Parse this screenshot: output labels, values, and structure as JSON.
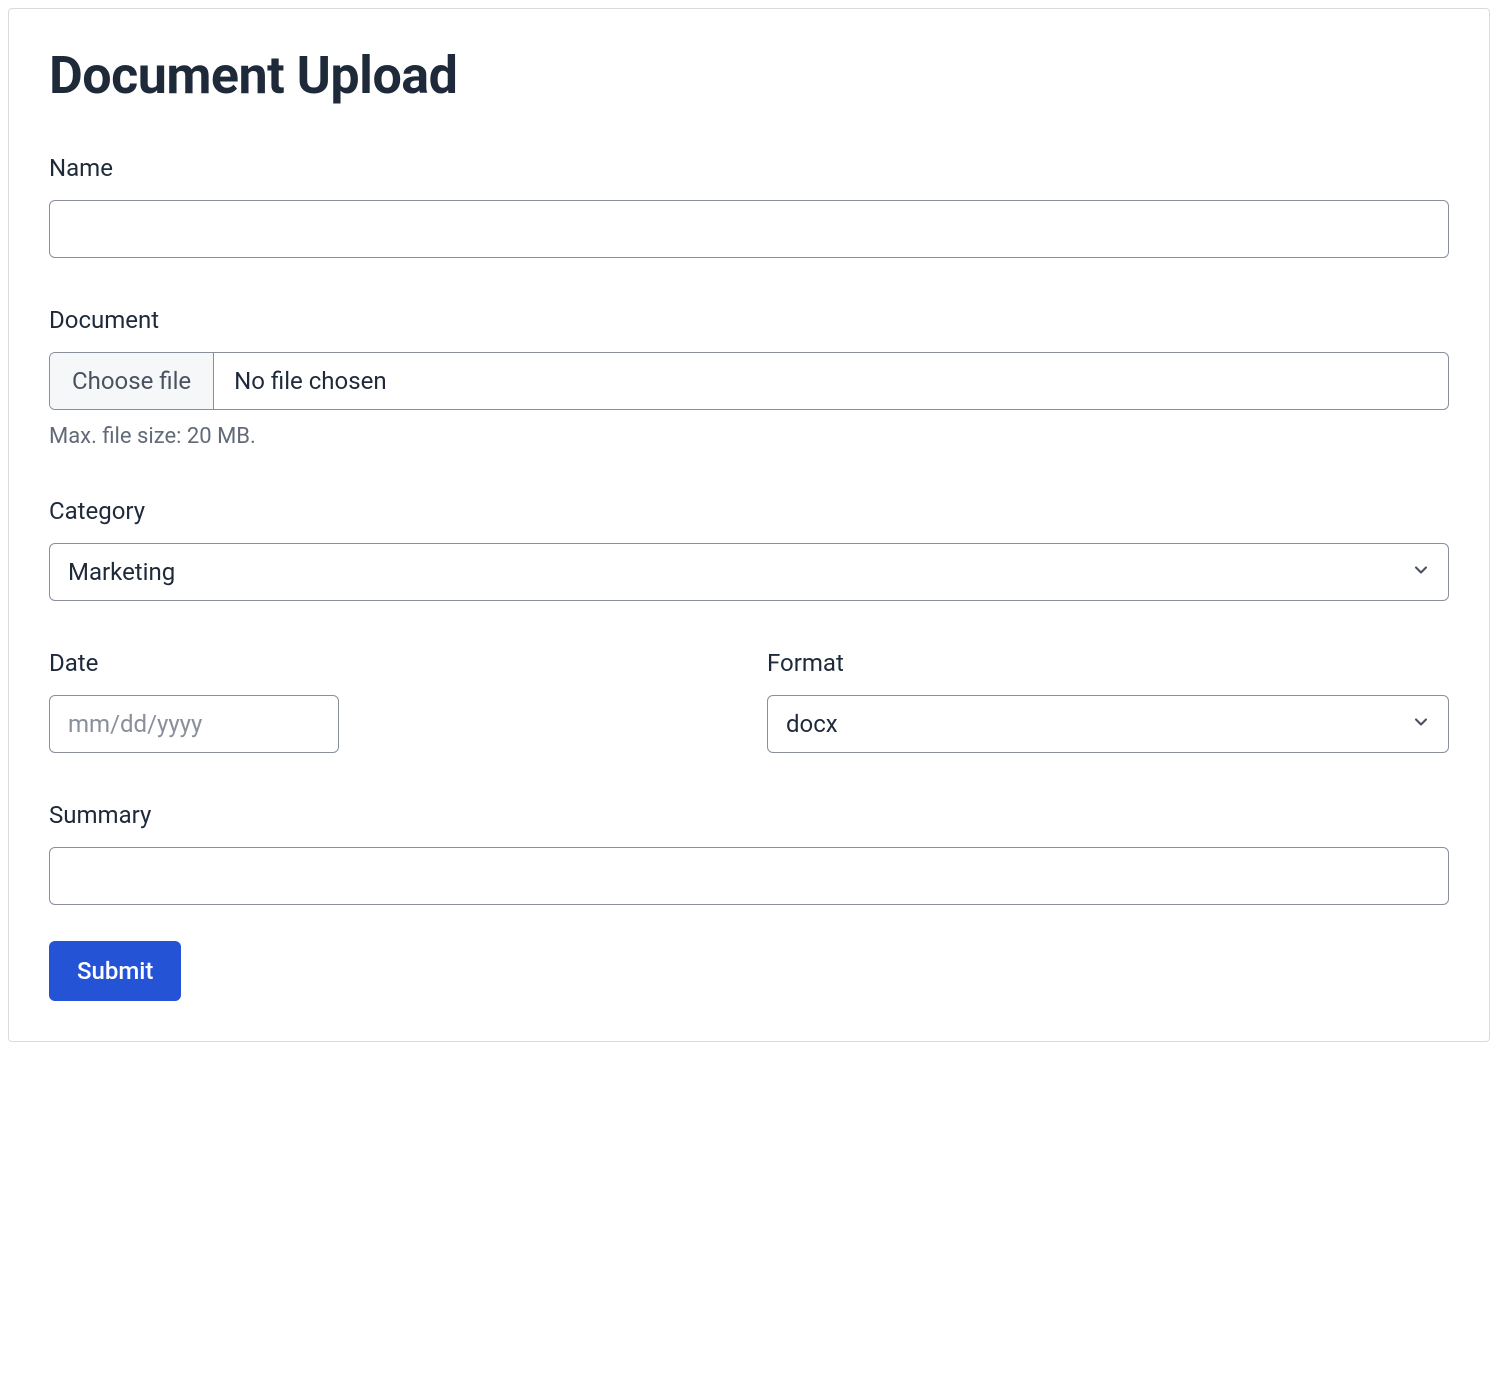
{
  "title": "Document Upload",
  "fields": {
    "name": {
      "label": "Name",
      "value": ""
    },
    "document": {
      "label": "Document",
      "choose_label": "Choose file",
      "status": "No file chosen",
      "hint": "Max. file size: 20 MB."
    },
    "category": {
      "label": "Category",
      "value": "Marketing"
    },
    "date": {
      "label": "Date",
      "placeholder": "mm/dd/yyyy",
      "value": ""
    },
    "format": {
      "label": "Format",
      "value": "docx"
    },
    "summary": {
      "label": "Summary",
      "value": ""
    }
  },
  "submit_label": "Submit"
}
